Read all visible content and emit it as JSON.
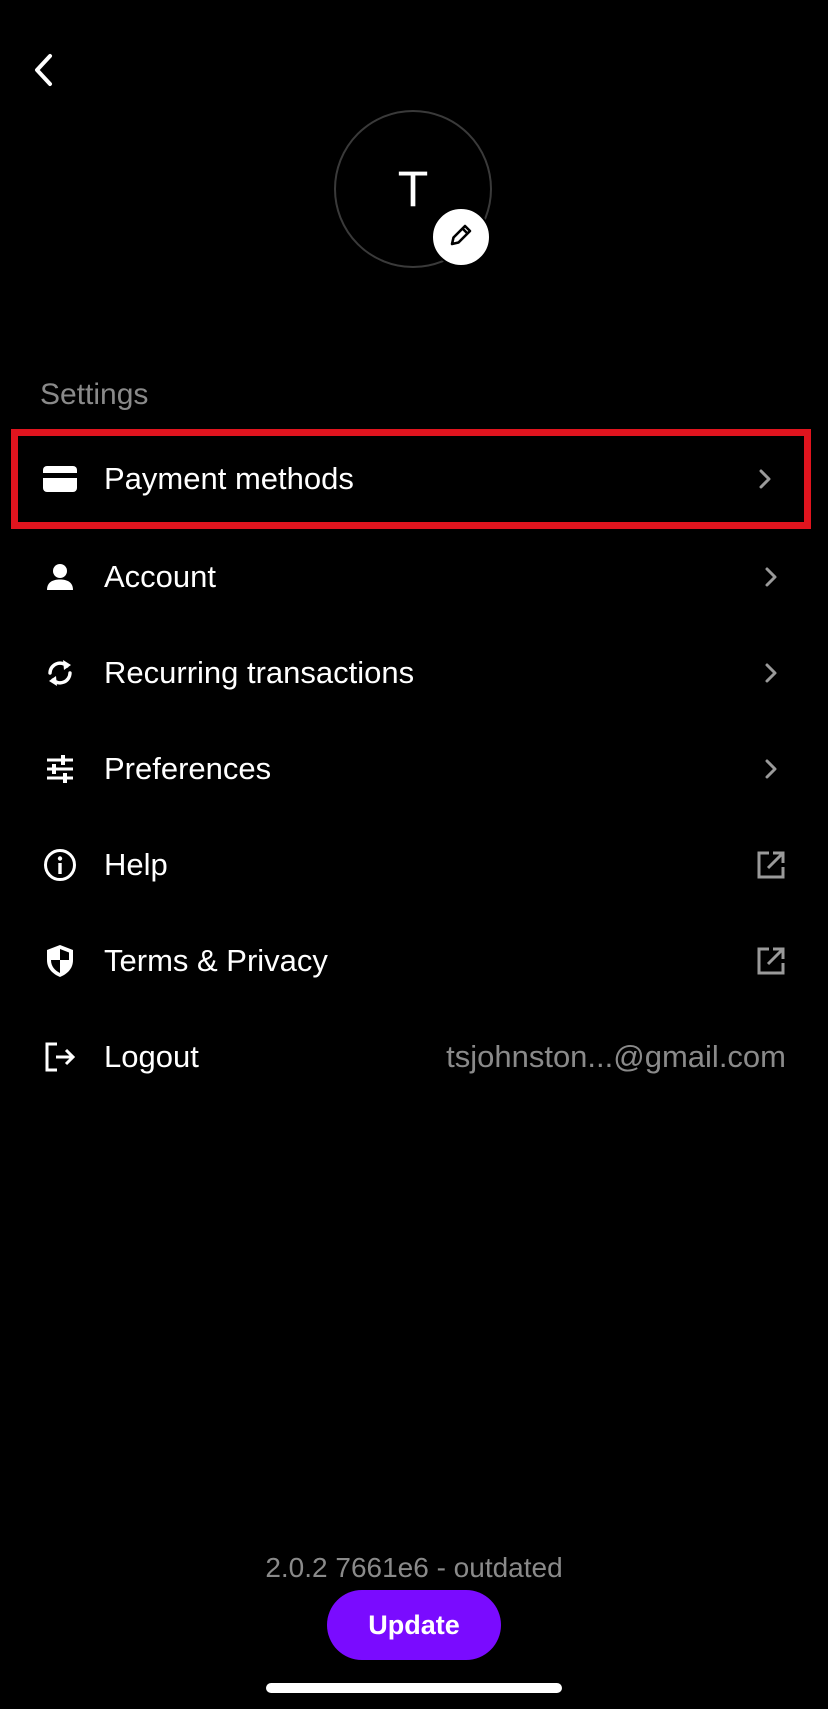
{
  "header": {
    "back_icon": "chevron-left-icon"
  },
  "profile": {
    "avatar_initial": "T",
    "edit_icon": "pencil-icon"
  },
  "settings": {
    "section_label": "Settings",
    "items": [
      {
        "label": "Payment methods",
        "icon": "credit-card-icon",
        "trail": "chevron-right-icon",
        "highlighted": true
      },
      {
        "label": "Account",
        "icon": "person-icon",
        "trail": "chevron-right-icon"
      },
      {
        "label": "Recurring transactions",
        "icon": "refresh-icon",
        "trail": "chevron-right-icon"
      },
      {
        "label": "Preferences",
        "icon": "sliders-icon",
        "trail": "chevron-right-icon"
      },
      {
        "label": "Help",
        "icon": "info-icon",
        "trail": "external-link-icon"
      },
      {
        "label": "Terms & Privacy",
        "icon": "shield-icon",
        "trail": "external-link-icon"
      },
      {
        "label": "Logout",
        "icon": "logout-icon",
        "value": "tsjohnston...@gmail.com"
      }
    ]
  },
  "footer": {
    "version": "2.0.2 7661e6 - outdated",
    "update_label": "Update"
  },
  "colors": {
    "background": "#000000",
    "accent": "#7a0bff",
    "highlight_border": "#e0141e",
    "muted_text": "#8a8a8a"
  }
}
